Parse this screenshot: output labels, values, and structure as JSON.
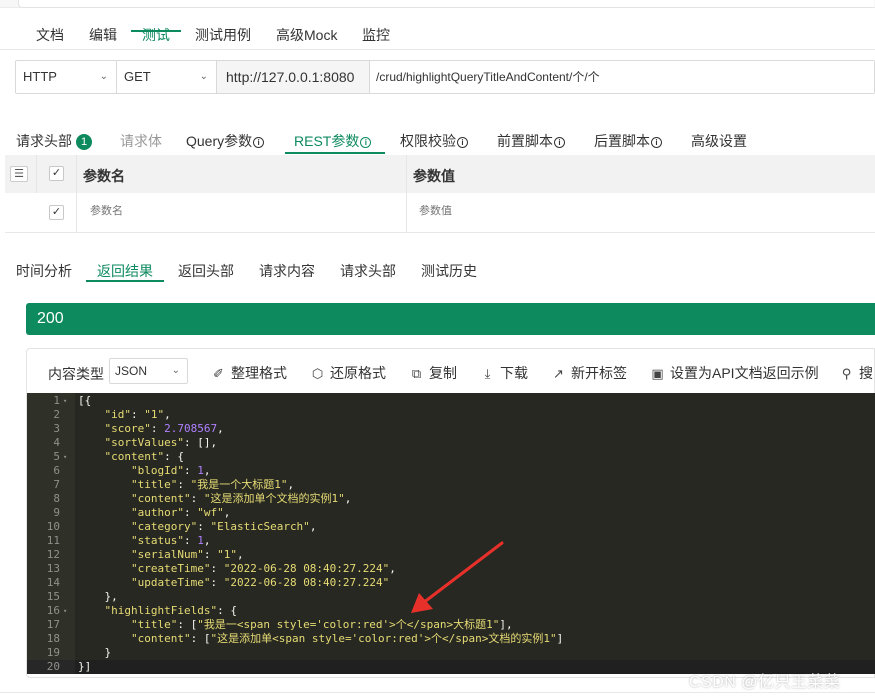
{
  "main_tabs": [
    {
      "label": "文档"
    },
    {
      "label": "编辑"
    },
    {
      "label": "测试"
    },
    {
      "label": "测试用例"
    },
    {
      "label": "高级Mock"
    },
    {
      "label": "监控"
    }
  ],
  "active_main_tab": "测试",
  "request": {
    "protocol": "HTTP",
    "method": "GET",
    "base_url": "http://127.0.0.1:8080",
    "path": "/crud/highlightQueryTitleAndContent/个/个"
  },
  "request_tabs": [
    {
      "label": "请求头部",
      "badge": "1"
    },
    {
      "label": "请求体"
    },
    {
      "label": "Query参数"
    },
    {
      "label": "REST参数"
    },
    {
      "label": "权限校验"
    },
    {
      "label": "前置脚本"
    },
    {
      "label": "后置脚本"
    },
    {
      "label": "高级设置"
    }
  ],
  "active_request_tab": "REST参数",
  "param_table": {
    "col_name": "参数名",
    "col_value": "参数值",
    "name_placeholder": "参数名",
    "value_placeholder": "参数值"
  },
  "response_tabs": [
    {
      "label": "时间分析"
    },
    {
      "label": "返回结果"
    },
    {
      "label": "返回头部"
    },
    {
      "label": "请求内容"
    },
    {
      "label": "请求头部"
    },
    {
      "label": "测试历史"
    }
  ],
  "active_response_tab": "返回结果",
  "status_code": "200",
  "toolbar": {
    "content_type_label": "内容类型",
    "content_type_value": "JSON",
    "format_label": "整理格式",
    "restore_label": "还原格式",
    "copy_label": "复制",
    "download_label": "下载",
    "new_tab_label": "新开标签",
    "set_example_label": "设置为API文档返回示例",
    "search_label": "搜"
  },
  "code_lines": [
    {
      "n": "1",
      "fold": true,
      "text": "[{"
    },
    {
      "n": "2",
      "text": "    \"id\": \"1\","
    },
    {
      "n": "3",
      "text": "    \"score\": 2.708567,"
    },
    {
      "n": "4",
      "text": "    \"sortValues\": [],"
    },
    {
      "n": "5",
      "fold": true,
      "text": "    \"content\": {"
    },
    {
      "n": "6",
      "text": "        \"blogId\": 1,"
    },
    {
      "n": "7",
      "text": "        \"title\": \"我是一个大标题1\","
    },
    {
      "n": "8",
      "text": "        \"content\": \"这是添加单个文档的实例1\","
    },
    {
      "n": "9",
      "text": "        \"author\": \"wf\","
    },
    {
      "n": "10",
      "text": "        \"category\": \"ElasticSearch\","
    },
    {
      "n": "11",
      "text": "        \"status\": 1,"
    },
    {
      "n": "12",
      "text": "        \"serialNum\": \"1\","
    },
    {
      "n": "13",
      "text": "        \"createTime\": \"2022-06-28 08:40:27.224\","
    },
    {
      "n": "14",
      "text": "        \"updateTime\": \"2022-06-28 08:40:27.224\""
    },
    {
      "n": "15",
      "text": "    },"
    },
    {
      "n": "16",
      "fold": true,
      "text": "    \"highlightFields\": {"
    },
    {
      "n": "17",
      "text": "        \"title\": [\"我是一<span style='color:red'>个</span>大标题1\"],"
    },
    {
      "n": "18",
      "text": "        \"content\": [\"这是添加单<span style='color:red'>个</span>文档的实例1\"]"
    },
    {
      "n": "19",
      "text": "    }"
    },
    {
      "n": "20",
      "text": "}]"
    }
  ],
  "watermark": "CSDN @亿只王菜菜",
  "colors": {
    "accent": "#0e8a5f",
    "editor_bg": "#272822",
    "key": "#e6db74",
    "number": "#ae81ff",
    "punct": "#f8f8f2",
    "arrow": "#e8302a"
  },
  "icons": [
    "chevron-down-icon",
    "info-icon",
    "menu-icon",
    "check-icon",
    "brush-icon",
    "cube-icon",
    "copy-icon",
    "download-icon",
    "external-link-icon",
    "save-icon",
    "search-icon",
    "fold-arrow-icon"
  ]
}
